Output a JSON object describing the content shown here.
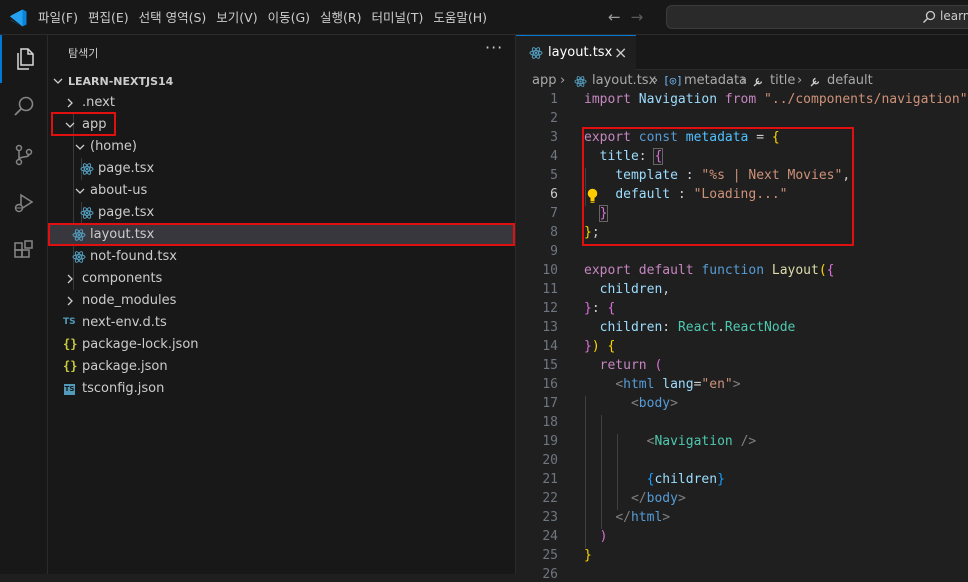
{
  "menu": [
    "파일(F)",
    "편집(E)",
    "선택 영역(S)",
    "보기(V)",
    "이동(G)",
    "실행(R)",
    "터미널(T)",
    "도움말(H)"
  ],
  "search": {
    "text": "learn-"
  },
  "sidebar": {
    "title": "탐색기",
    "more": "···",
    "root": "LEARN-NEXTJS14",
    "items": [
      {
        "label": ".next"
      },
      {
        "label": "app"
      },
      {
        "label": "(home)"
      },
      {
        "label": "page.tsx"
      },
      {
        "label": "about-us"
      },
      {
        "label": "page.tsx"
      },
      {
        "label": "layout.tsx"
      },
      {
        "label": "not-found.tsx"
      },
      {
        "label": "components"
      },
      {
        "label": "node_modules"
      },
      {
        "label": "next-env.d.ts",
        "icon": "TS"
      },
      {
        "label": "package-lock.json",
        "icon": "{}"
      },
      {
        "label": "package.json",
        "icon": "{}"
      },
      {
        "label": "tsconfig.json",
        "icon": "TS"
      }
    ]
  },
  "editor": {
    "tab": {
      "label": "layout.tsx",
      "close": "×"
    },
    "breadcrumbs": [
      "app",
      "layout.tsx",
      "metadata",
      "title",
      "default"
    ],
    "line_numbers": [
      "1",
      "2",
      "3",
      "4",
      "5",
      "6",
      "7",
      "8",
      "9",
      "10",
      "11",
      "12",
      "13",
      "14",
      "15",
      "16",
      "17",
      "18",
      "19",
      "20",
      "21",
      "22",
      "23",
      "24",
      "25",
      "26"
    ]
  },
  "colors": {
    "accent": "#0078d4",
    "highlight_box": "#e01010",
    "selected_row": "#37373d"
  }
}
